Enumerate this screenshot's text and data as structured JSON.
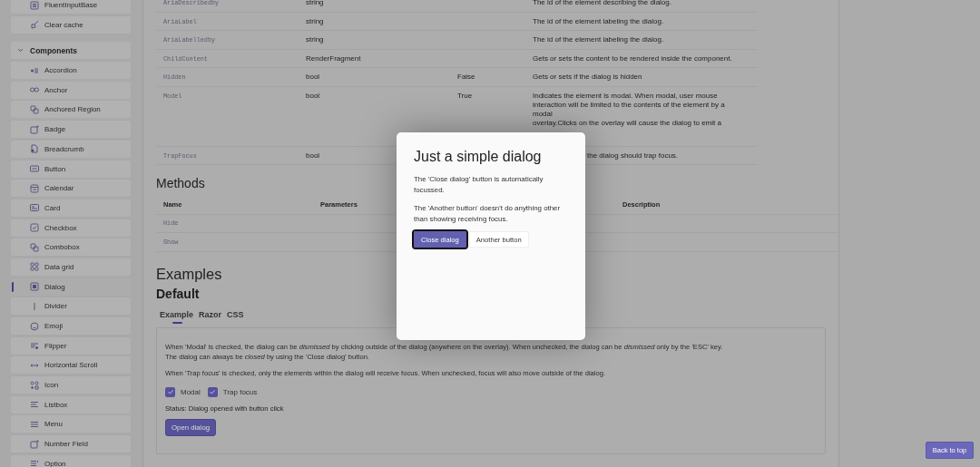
{
  "sidebar": {
    "items": [
      {
        "label": "FluentInputBase",
        "selected": false
      },
      {
        "label": "Clear cache",
        "selected": false
      }
    ],
    "group": {
      "label": "Components",
      "expanded": true,
      "items": [
        {
          "label": "Accordion",
          "selected": false
        },
        {
          "label": "Anchor",
          "selected": false
        },
        {
          "label": "Anchored Region",
          "selected": false
        },
        {
          "label": "Badge",
          "selected": false
        },
        {
          "label": "Breadcrumb",
          "selected": false
        },
        {
          "label": "Button",
          "selected": false
        },
        {
          "label": "Calendar",
          "selected": false
        },
        {
          "label": "Card",
          "selected": false
        },
        {
          "label": "Checkbox",
          "selected": false
        },
        {
          "label": "Combobox",
          "selected": false
        },
        {
          "label": "Data grid",
          "selected": false
        },
        {
          "label": "Dialog",
          "selected": true
        },
        {
          "label": "Divider",
          "selected": false
        },
        {
          "label": "Emoji",
          "selected": false
        },
        {
          "label": "Flipper",
          "selected": false
        },
        {
          "label": "Horizontal Scroll",
          "selected": false
        },
        {
          "label": "Icon",
          "selected": false
        },
        {
          "label": "Listbox",
          "selected": false
        },
        {
          "label": "Menu",
          "selected": false
        },
        {
          "label": "Number Field",
          "selected": false
        },
        {
          "label": "Option",
          "selected": false
        }
      ]
    }
  },
  "properties": {
    "rows": [
      {
        "name": "AriaDescribedby",
        "type": "string",
        "description": "The id of the element describing the dialog."
      },
      {
        "name": "AriaLabel",
        "type": "string",
        "description": "The id of the element labeling the dialog."
      },
      {
        "name": "AriaLabelledby",
        "type": "string",
        "description": "The id of the element labeling the dialog."
      },
      {
        "name": "ChildContent",
        "type": "RenderFragment",
        "description": "Gets or sets the content to be rendered inside the component."
      },
      {
        "name": "Hidden",
        "type": "bool",
        "default": "False",
        "description": "Gets or sets if the dialog is hidden"
      },
      {
        "name": "Model",
        "type": "bool",
        "default": "True",
        "description": "Indicates the element is modal. When modal, user mouse\ninteraction will be limited to the contents of the element by a\nmodal\noverlay.Clicks on the overlay will cause the dialog to emit a"
      },
      {
        "name": "TrapFocus",
        "type": "bool",
        "description": "the dialog should trap focus."
      }
    ]
  },
  "methods": {
    "heading": "Methods",
    "columns": [
      "Name",
      "Parameters",
      "Description"
    ],
    "rows": [
      {
        "name": "Hide"
      },
      {
        "name": "Show"
      }
    ]
  },
  "examples": {
    "heading": "Examples",
    "subheading": "Default",
    "tabs": [
      {
        "label": "Example",
        "selected": true
      },
      {
        "label": "Razor",
        "selected": false
      },
      {
        "label": "CSS",
        "selected": false
      }
    ],
    "paragraphs": [
      [
        "When 'Modal' is checked, the dialog can be *dismissed* by clicking outside of the dialog (anywhere on the overlay). When unchecked, the dialog can be *dismissed* only by the 'ESC' key.",
        "The dialog can always be *closed* by using the 'Close dialog' button."
      ],
      [
        "When 'Trap focus' is checked, only the elements within the dialog will receive focus. When unchecked, focus will also move outside of the dialog."
      ]
    ],
    "checkboxes": [
      {
        "label": "Modal",
        "checked": true
      },
      {
        "label": "Trap focus",
        "checked": true
      }
    ],
    "status": "Status: Dialog opened with button click",
    "button": "Open dialog"
  },
  "dialog": {
    "title": "Just a simple dialog",
    "paragraphs": [
      "The 'Close dialog' button is automatically focussed.",
      "The 'Another button' doesn't do anything other than showing receiving focus."
    ],
    "buttons": [
      {
        "label": "Close dialog",
        "kind": "primary",
        "focused": true
      },
      {
        "label": "Another button",
        "kind": "secondary",
        "focused": false
      }
    ]
  },
  "back_to_top": "Back to top"
}
